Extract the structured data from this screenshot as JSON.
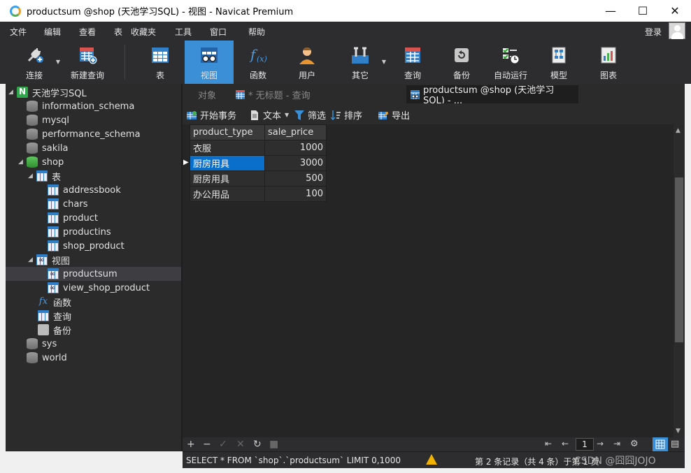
{
  "window": {
    "title": "productsum @shop (天池学习SQL) - 视图 - Navicat Premium",
    "controls": [
      "—",
      "☐",
      "✕"
    ]
  },
  "menu": {
    "items": [
      "文件",
      "编辑",
      "查看",
      "表",
      "收藏夹",
      "工具",
      "窗口",
      "帮助"
    ],
    "login": "登录"
  },
  "toolbar": {
    "buttons": [
      {
        "label": "连接",
        "icon": "plug-icon"
      },
      {
        "label": "新建查询",
        "icon": "new-query-icon"
      },
      {
        "label": "表",
        "icon": "table-icon"
      },
      {
        "label": "视图",
        "icon": "view-icon",
        "active": true
      },
      {
        "label": "函数",
        "icon": "function-icon"
      },
      {
        "label": "用户",
        "icon": "user-icon"
      },
      {
        "label": "其它",
        "icon": "tools-icon"
      },
      {
        "label": "查询",
        "icon": "query-icon"
      },
      {
        "label": "备份",
        "icon": "backup-icon"
      },
      {
        "label": "自动运行",
        "icon": "schedule-icon"
      },
      {
        "label": "模型",
        "icon": "model-icon"
      },
      {
        "label": "图表",
        "icon": "chart-icon"
      }
    ]
  },
  "tree": {
    "connection": "天池学习SQL",
    "databases": [
      "information_schema",
      "mysql",
      "performance_schema",
      "sakila",
      "shop"
    ],
    "shop_children": {
      "tables_label": "表",
      "tables": [
        "addressbook",
        "chars",
        "product",
        "productins",
        "shop_product"
      ],
      "views_label": "视图",
      "views": [
        "productsum",
        "view_shop_product"
      ],
      "functions_label": "函数",
      "queries_label": "查询",
      "backups_label": "备份"
    },
    "other_databases": [
      "sys",
      "world"
    ]
  },
  "tabs": {
    "objects": "对象",
    "untitled_query": "* 无标题 - 查询",
    "active": "productsum @shop (天池学习SQL) - ..."
  },
  "object_toolbar": {
    "begin_transaction": "开始事务",
    "text": "文本",
    "filter": "筛选",
    "sort": "排序",
    "export": "导出"
  },
  "grid": {
    "columns": [
      "product_type",
      "sale_price"
    ],
    "rows": [
      [
        "衣服",
        "1000"
      ],
      [
        "厨房用具",
        "3000"
      ],
      [
        "厨房用具",
        "500"
      ],
      [
        "办公用品",
        "100"
      ]
    ],
    "selected_row": 1
  },
  "pager": {
    "page": "1"
  },
  "status": {
    "sql": "SELECT * FROM `shop`.`productsum` LIMIT 0,1000",
    "records": "第 2 条记录（共 4 条）于第 1 页",
    "watermark": "CSDN @囧囧JOJO"
  },
  "colors": {
    "accent": "#3a8fd6",
    "selection": "#0a6ecb",
    "panel": "#2b2b2b",
    "warning": "#f2b300"
  }
}
